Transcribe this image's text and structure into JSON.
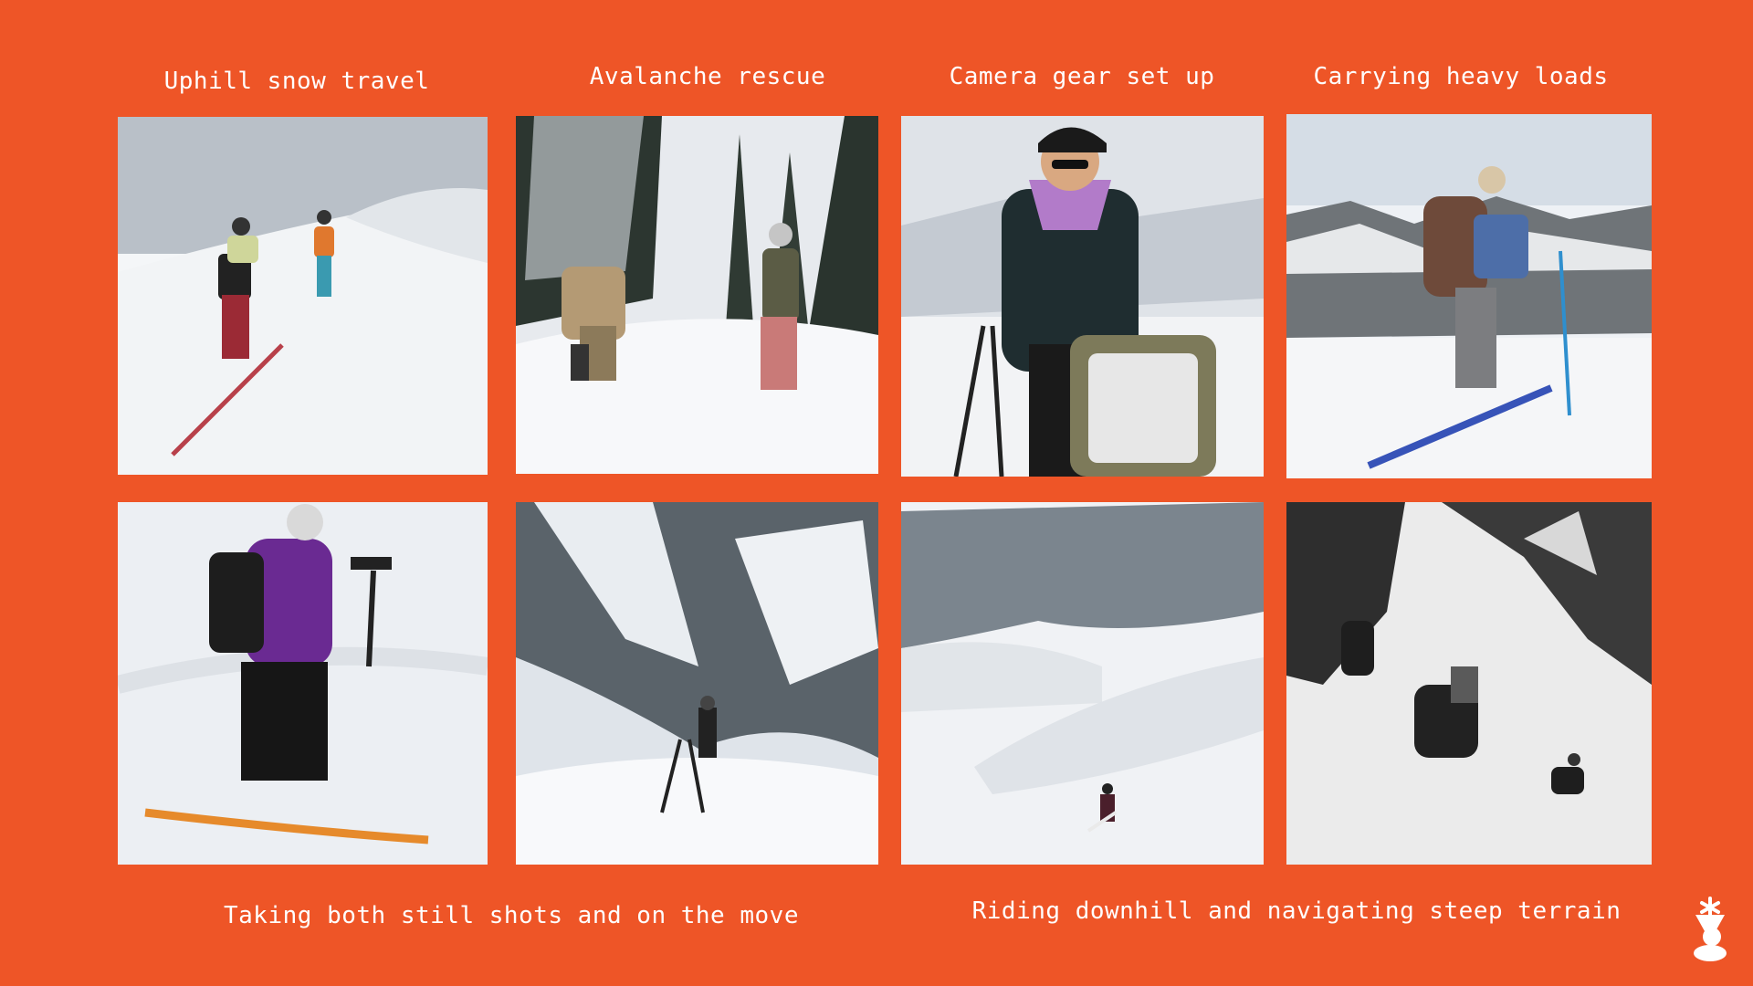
{
  "captions": {
    "uphill": "Uphill snow travel",
    "avalanche": "Avalanche rescue",
    "camera_gear": "Camera gear set up",
    "heavy_loads": "Carrying heavy loads",
    "stills_moving": "Taking both still shots and on the move",
    "riding_downhill": "Riding downhill and navigating steep terrain"
  },
  "photos": [
    {
      "subject": "two skiers skinning uphill on a snowy ridge"
    },
    {
      "subject": "two people digging in snow among snowy fir trees"
    },
    {
      "subject": "woman in cap and sunglasses with camera tripod and open pack"
    },
    {
      "subject": "woman with large backpack on skis above mountain valley"
    },
    {
      "subject": "snowboarder in purple jacket filming with gimbal camera"
    },
    {
      "subject": "photographer with tripod on snowy slope below steep mountain"
    },
    {
      "subject": "snowboarder riding down a snowy bowl"
    },
    {
      "subject": "black and white: riders hiking up a steep snowy couloir"
    }
  ],
  "colors": {
    "background": "#EE5527",
    "text": "#FFFFFF"
  },
  "logo": {
    "icon": "snowflake-figure-logo-icon"
  }
}
